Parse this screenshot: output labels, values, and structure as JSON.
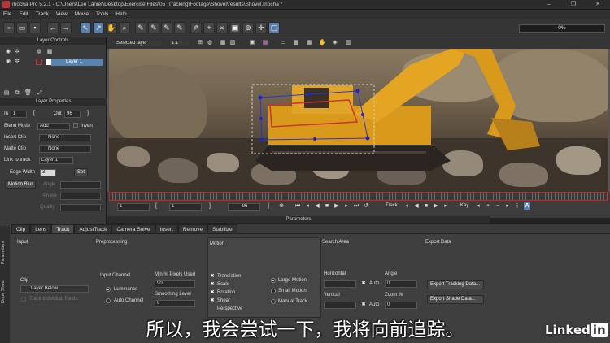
{
  "window": {
    "title": "mocha Pro 5.2.1 - C:\\Users\\Lee Lanier\\Desktop\\Exercise Files\\05_Tracking\\Footage\\Shovel\\results\\Shovel.mocha *",
    "minimize": "–",
    "maximize": "❐",
    "close": "✕"
  },
  "menu": [
    "File",
    "Edit",
    "Track",
    "View",
    "Movie",
    "Tools",
    "Help"
  ],
  "toolbar": {
    "progress": "0%"
  },
  "viewer_bar": {
    "layer_select": "Selected layer",
    "zoom": "1:1"
  },
  "layer_controls": {
    "title": "Layer Controls",
    "layer_name": "Layer 1"
  },
  "layer_properties": {
    "title": "Layer Properties",
    "in_label": "In",
    "in_value": "1",
    "out_label": "Out",
    "out_value": "96",
    "blend_mode_label": "Blend Mode",
    "blend_mode_value": "Add",
    "invert_label": "Invert",
    "insert_clip_label": "Insert Clip",
    "insert_clip_value": "None",
    "matte_clip_label": "Matte Clip",
    "matte_clip_value": "None",
    "link_label": "Link to track",
    "link_value": "Layer 1",
    "edge_width_label": "Edge Width",
    "edge_width_value": "3",
    "set_label": "Set",
    "motion_blur_label": "Motion Blur",
    "angle_label": "Angle",
    "phase_label": "Phase",
    "quality_label": "Quality"
  },
  "timeline": {
    "start_frame": "1",
    "current_frame": "1",
    "end_frame": "96",
    "track_label": "Track",
    "key_label": "Key"
  },
  "params_title": "Parameters",
  "side_tabs": [
    "Parameters",
    "Dope Sheet"
  ],
  "tabs": [
    "Clip",
    "Lens",
    "Track",
    "AdjustTrack",
    "Camera Solve",
    "Insert",
    "Remove",
    "Stabilize"
  ],
  "active_tab": "Track",
  "track_panel": {
    "input_label": "Input",
    "preprocessing_label": "Preprocessing",
    "clip_label": "Clip",
    "clip_value": "Layer Below",
    "track_fields_label": "Track Individual Fields",
    "input_channel_label": "Input Channel",
    "luminance_label": "Luminance",
    "auto_channel_label": "Auto Channel",
    "min_pixels_label": "Min % Pixels Used",
    "min_pixels_value": "90",
    "smoothing_label": "Smoothing Level",
    "smoothing_value": "0",
    "motion_label": "Motion",
    "motion_items": [
      "Translation",
      "Scale",
      "Rotation",
      "Shear",
      "Perspective"
    ],
    "large_motion_label": "Large Motion",
    "small_motion_label": "Small Motion",
    "manual_track_label": "Manual Track",
    "search_area_label": "Search Area",
    "horizontal_label": "Horizontal",
    "vertical_label": "Vertical",
    "auto_label": "Auto",
    "angle_label": "Angle",
    "angle_value": "0",
    "zoom_label": "Zoom %",
    "zoom_value": "0",
    "export_data_label": "Export Data",
    "export_tracking_label": "Export Tracking Data...",
    "export_shape_label": "Export Shape Data..."
  },
  "subtitle": "所以，我会尝试一下，我将向前追踪。",
  "watermark_left": "Linked",
  "watermark_right": "in"
}
